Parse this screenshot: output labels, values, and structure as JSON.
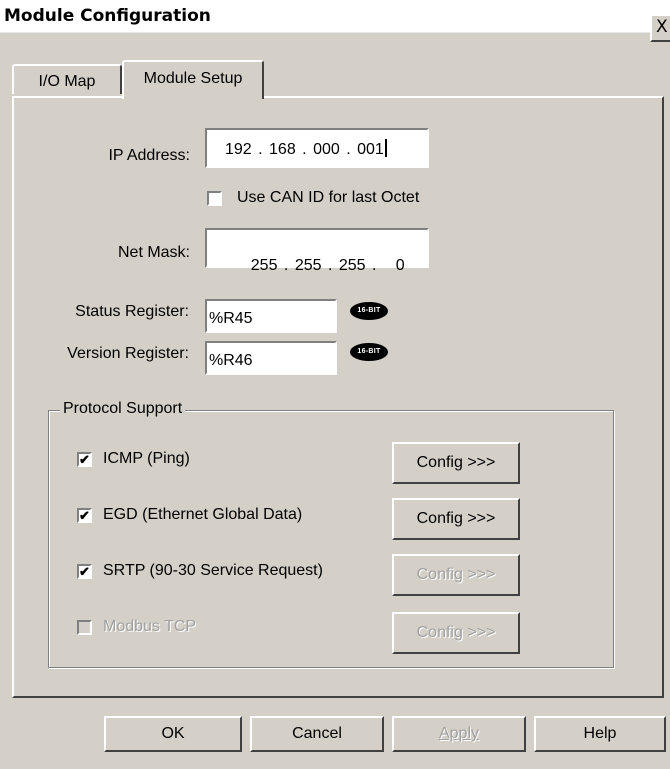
{
  "window": {
    "title": "Module Configuration",
    "close_glyph": "X"
  },
  "tabs": [
    {
      "label": "I/O Map",
      "active": false
    },
    {
      "label": "Module Setup",
      "active": true
    }
  ],
  "ip": {
    "label": "IP Address:",
    "value": "192 . 168 . 000 . 001",
    "use_can_id": {
      "label": "Use CAN ID for last Octet",
      "checked": false
    }
  },
  "netmask": {
    "label": "Net Mask:",
    "value": "255 . 255 . 255 .   0"
  },
  "status_register": {
    "label": "Status Register:",
    "value": "%R45",
    "badge": "16-BIT"
  },
  "version_register": {
    "label": "Version Register:",
    "value": "%R46",
    "badge": "16-BIT"
  },
  "protocol_support": {
    "title": "Protocol Support",
    "items": [
      {
        "label": "ICMP (Ping)",
        "checked": true,
        "enabled": true,
        "config_label": "Config >>>",
        "config_enabled": true
      },
      {
        "label": "EGD (Ethernet Global Data)",
        "checked": true,
        "enabled": true,
        "config_label": "Config >>>",
        "config_enabled": true
      },
      {
        "label": "SRTP (90-30 Service Request)",
        "checked": true,
        "enabled": true,
        "config_label": "Config >>>",
        "config_enabled": false
      },
      {
        "label": "Modbus TCP",
        "checked": false,
        "enabled": false,
        "config_label": "Config >>>",
        "config_enabled": false
      }
    ]
  },
  "buttons": {
    "ok": "OK",
    "cancel": "Cancel",
    "apply": "Apply",
    "help": "Help"
  },
  "check_glyph": "✔"
}
